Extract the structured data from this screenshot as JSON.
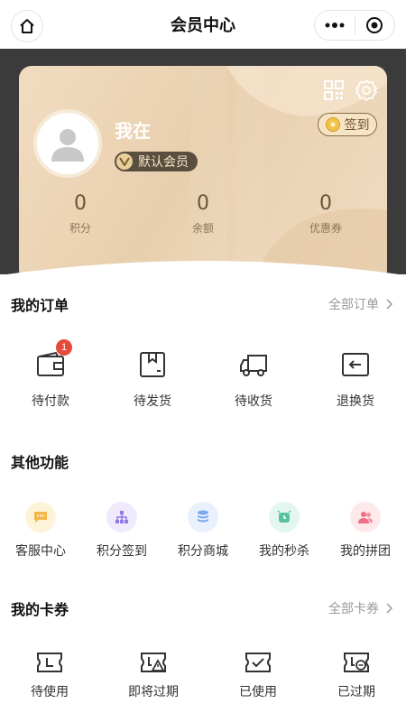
{
  "nav": {
    "title": "会员中心"
  },
  "colors": {
    "accent": "#e8cfae",
    "dark_band": "#3b3b3b",
    "badge": "#e64a3c"
  },
  "member": {
    "name": "我在",
    "level": "默认会员",
    "signin_label": "签到",
    "stats": [
      {
        "value": "0",
        "label": "积分"
      },
      {
        "value": "0",
        "label": "余额"
      },
      {
        "value": "0",
        "label": "优惠券"
      }
    ]
  },
  "orders": {
    "title": "我的订单",
    "link": "全部订单",
    "items": [
      {
        "label": "待付款",
        "icon": "wallet-icon",
        "badge": "1"
      },
      {
        "label": "待发货",
        "icon": "box-icon"
      },
      {
        "label": "待收货",
        "icon": "truck-icon"
      },
      {
        "label": "退换货",
        "icon": "return-icon"
      }
    ]
  },
  "functions": {
    "title": "其他功能",
    "items": [
      {
        "label": "客服中心",
        "icon": "chat-icon",
        "bg": "#fdf3d8",
        "fg": "#f5b74a"
      },
      {
        "label": "积分签到",
        "icon": "network-icon",
        "bg": "#efeafd",
        "fg": "#8f7ae6"
      },
      {
        "label": "积分商城",
        "icon": "coins-icon",
        "bg": "#e9f1fd",
        "fg": "#7ca6ef"
      },
      {
        "label": "我的秒杀",
        "icon": "clock-icon",
        "bg": "#e4f6f0",
        "fg": "#57c39b"
      },
      {
        "label": "我的拼团",
        "icon": "users-icon",
        "bg": "#fde8ea",
        "fg": "#ef6f86"
      }
    ]
  },
  "coupons": {
    "title": "我的卡券",
    "link": "全部卡券",
    "items": [
      {
        "label": "待使用",
        "icon": "ticket-icon"
      },
      {
        "label": "即将过期",
        "icon": "ticket-warning-icon"
      },
      {
        "label": "已使用",
        "icon": "ticket-check-icon"
      },
      {
        "label": "已过期",
        "icon": "ticket-expired-icon"
      }
    ]
  }
}
